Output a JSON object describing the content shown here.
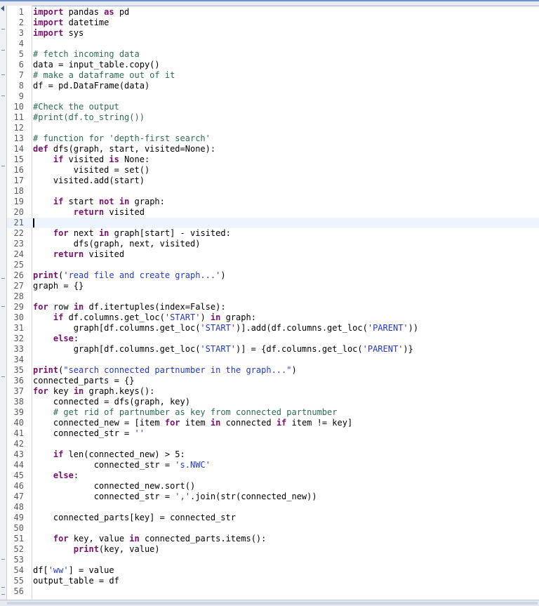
{
  "editor": {
    "current_line": 21,
    "lines": [
      {
        "n": "1",
        "tokens": [
          [
            "kw",
            "import"
          ],
          [
            "t",
            " pandas "
          ],
          [
            "kw",
            "as"
          ],
          [
            "t",
            " pd"
          ]
        ]
      },
      {
        "n": "2",
        "tokens": [
          [
            "kw",
            "import"
          ],
          [
            "t",
            " datetime"
          ]
        ]
      },
      {
        "n": "3",
        "tokens": [
          [
            "kw",
            "import"
          ],
          [
            "t",
            " sys"
          ]
        ]
      },
      {
        "n": "4",
        "tokens": []
      },
      {
        "n": "5",
        "tokens": [
          [
            "cm",
            "# fetch incoming data"
          ]
        ]
      },
      {
        "n": "6",
        "tokens": [
          [
            "t",
            "data = input_table.copy()"
          ]
        ]
      },
      {
        "n": "7",
        "tokens": [
          [
            "cm",
            "# make a dataframe out of it"
          ]
        ]
      },
      {
        "n": "8",
        "tokens": [
          [
            "t",
            "df = pd.DataFrame(data)"
          ]
        ]
      },
      {
        "n": "9",
        "tokens": []
      },
      {
        "n": "10",
        "tokens": [
          [
            "cm",
            "#Check the output"
          ]
        ]
      },
      {
        "n": "11",
        "tokens": [
          [
            "cm",
            "#print(df.to_string())"
          ]
        ]
      },
      {
        "n": "12",
        "tokens": []
      },
      {
        "n": "13",
        "tokens": [
          [
            "cm",
            "# function for 'depth-first search'"
          ]
        ]
      },
      {
        "n": "14",
        "tokens": [
          [
            "kw",
            "def"
          ],
          [
            "t",
            " dfs(graph, start, visited=None):"
          ]
        ]
      },
      {
        "n": "15",
        "tokens": [
          [
            "t",
            "    "
          ],
          [
            "kw",
            "if"
          ],
          [
            "t",
            " visited "
          ],
          [
            "kw",
            "is"
          ],
          [
            "t",
            " None:"
          ]
        ]
      },
      {
        "n": "16",
        "tokens": [
          [
            "t",
            "        visited = set()"
          ]
        ]
      },
      {
        "n": "17",
        "tokens": [
          [
            "t",
            "    visited.add(start)"
          ]
        ]
      },
      {
        "n": "18",
        "tokens": []
      },
      {
        "n": "19",
        "tokens": [
          [
            "t",
            "    "
          ],
          [
            "kw",
            "if"
          ],
          [
            "t",
            " start "
          ],
          [
            "kw",
            "not"
          ],
          [
            "t",
            " "
          ],
          [
            "kw",
            "in"
          ],
          [
            "t",
            " graph:"
          ]
        ]
      },
      {
        "n": "20",
        "tokens": [
          [
            "t",
            "        "
          ],
          [
            "kw",
            "return"
          ],
          [
            "t",
            " visited"
          ]
        ]
      },
      {
        "n": "21",
        "tokens": []
      },
      {
        "n": "22",
        "tokens": [
          [
            "t",
            "    "
          ],
          [
            "kw",
            "for"
          ],
          [
            "t",
            " next "
          ],
          [
            "kw",
            "in"
          ],
          [
            "t",
            " graph[start] - visited:"
          ]
        ]
      },
      {
        "n": "23",
        "tokens": [
          [
            "t",
            "        dfs(graph, next, visited)"
          ]
        ]
      },
      {
        "n": "24",
        "tokens": [
          [
            "t",
            "    "
          ],
          [
            "kw",
            "return"
          ],
          [
            "t",
            " visited"
          ]
        ]
      },
      {
        "n": "25",
        "tokens": []
      },
      {
        "n": "26",
        "tokens": [
          [
            "kw",
            "print"
          ],
          [
            "t",
            "("
          ],
          [
            "st",
            "'read file and create graph...'"
          ],
          [
            "t",
            ")"
          ]
        ]
      },
      {
        "n": "27",
        "tokens": [
          [
            "t",
            "graph = {}"
          ]
        ]
      },
      {
        "n": "28",
        "tokens": []
      },
      {
        "n": "29",
        "tokens": [
          [
            "kw",
            "for"
          ],
          [
            "t",
            " row "
          ],
          [
            "kw",
            "in"
          ],
          [
            "t",
            " df.itertuples(index=False):"
          ]
        ]
      },
      {
        "n": "30",
        "tokens": [
          [
            "t",
            "    "
          ],
          [
            "kw",
            "if"
          ],
          [
            "t",
            " df.columns.get_loc("
          ],
          [
            "st",
            "'START'"
          ],
          [
            "t",
            ") "
          ],
          [
            "kw",
            "in"
          ],
          [
            "t",
            " graph:"
          ]
        ]
      },
      {
        "n": "31",
        "tokens": [
          [
            "t",
            "        graph[df.columns.get_loc("
          ],
          [
            "st",
            "'START'"
          ],
          [
            "t",
            ")].add(df.columns.get_loc("
          ],
          [
            "st",
            "'PARENT'"
          ],
          [
            "t",
            "))"
          ]
        ]
      },
      {
        "n": "32",
        "tokens": [
          [
            "t",
            "    "
          ],
          [
            "kw",
            "else"
          ],
          [
            "t",
            ":"
          ]
        ]
      },
      {
        "n": "33",
        "tokens": [
          [
            "t",
            "        graph[df.columns.get_loc("
          ],
          [
            "st",
            "'START'"
          ],
          [
            "t",
            ")] = {df.columns.get_loc("
          ],
          [
            "st",
            "'PARENT'"
          ],
          [
            "t",
            ")}"
          ]
        ]
      },
      {
        "n": "34",
        "tokens": []
      },
      {
        "n": "35",
        "tokens": [
          [
            "kw",
            "print"
          ],
          [
            "t",
            "("
          ],
          [
            "st",
            "\"search connected partnumber in the graph...\""
          ],
          [
            "t",
            ")"
          ]
        ]
      },
      {
        "n": "36",
        "tokens": [
          [
            "t",
            "connected_parts = {}"
          ]
        ]
      },
      {
        "n": "37",
        "tokens": [
          [
            "kw",
            "for"
          ],
          [
            "t",
            " key "
          ],
          [
            "kw",
            "in"
          ],
          [
            "t",
            " graph.keys():"
          ]
        ]
      },
      {
        "n": "38",
        "tokens": [
          [
            "t",
            "    connected = dfs(graph, key)"
          ]
        ]
      },
      {
        "n": "39",
        "tokens": [
          [
            "t",
            "    "
          ],
          [
            "cm",
            "# get rid of partnumber as key from connected partnumber"
          ]
        ]
      },
      {
        "n": "40",
        "tokens": [
          [
            "t",
            "    connected_new = [item "
          ],
          [
            "kw",
            "for"
          ],
          [
            "t",
            " item "
          ],
          [
            "kw",
            "in"
          ],
          [
            "t",
            " connected "
          ],
          [
            "kw",
            "if"
          ],
          [
            "t",
            " item != key]"
          ]
        ]
      },
      {
        "n": "41",
        "tokens": [
          [
            "t",
            "    connected_str = "
          ],
          [
            "st",
            "''"
          ]
        ]
      },
      {
        "n": "42",
        "tokens": []
      },
      {
        "n": "43",
        "tokens": [
          [
            "t",
            "    "
          ],
          [
            "kw",
            "if"
          ],
          [
            "t",
            " len(connected_new) > 5:"
          ]
        ]
      },
      {
        "n": "44",
        "tokens": [
          [
            "t",
            "            connected_str = "
          ],
          [
            "st",
            "'s.NWC'"
          ]
        ]
      },
      {
        "n": "45",
        "tokens": [
          [
            "t",
            "    "
          ],
          [
            "kw",
            "else"
          ],
          [
            "t",
            ":"
          ]
        ]
      },
      {
        "n": "46",
        "tokens": [
          [
            "t",
            "            connected_new.sort()"
          ]
        ]
      },
      {
        "n": "47",
        "tokens": [
          [
            "t",
            "            connected_str = "
          ],
          [
            "st",
            "','"
          ],
          [
            "t",
            ".join(str(connected_new))"
          ]
        ]
      },
      {
        "n": "48",
        "tokens": []
      },
      {
        "n": "49",
        "tokens": [
          [
            "t",
            "    connected_parts[key] = connected_str"
          ]
        ]
      },
      {
        "n": "50",
        "tokens": []
      },
      {
        "n": "51",
        "tokens": [
          [
            "t",
            "    "
          ],
          [
            "kw",
            "for"
          ],
          [
            "t",
            " key, value "
          ],
          [
            "kw",
            "in"
          ],
          [
            "t",
            " connected_parts.items():"
          ]
        ]
      },
      {
        "n": "52",
        "tokens": [
          [
            "t",
            "        "
          ],
          [
            "kw",
            "print"
          ],
          [
            "t",
            "(key, value)"
          ]
        ]
      },
      {
        "n": "53",
        "tokens": []
      },
      {
        "n": "54",
        "tokens": [
          [
            "t",
            "df["
          ],
          [
            "st",
            "'ww'"
          ],
          [
            "t",
            "] = value"
          ]
        ]
      },
      {
        "n": "55",
        "tokens": [
          [
            "t",
            "output_table = df"
          ]
        ]
      },
      {
        "n": "56",
        "tokens": []
      }
    ]
  },
  "colors": {
    "keyword": "#7a0d6e",
    "comment": "#2d6b52",
    "string": "#2338c8",
    "current_line_bg": "#eef4fc"
  }
}
